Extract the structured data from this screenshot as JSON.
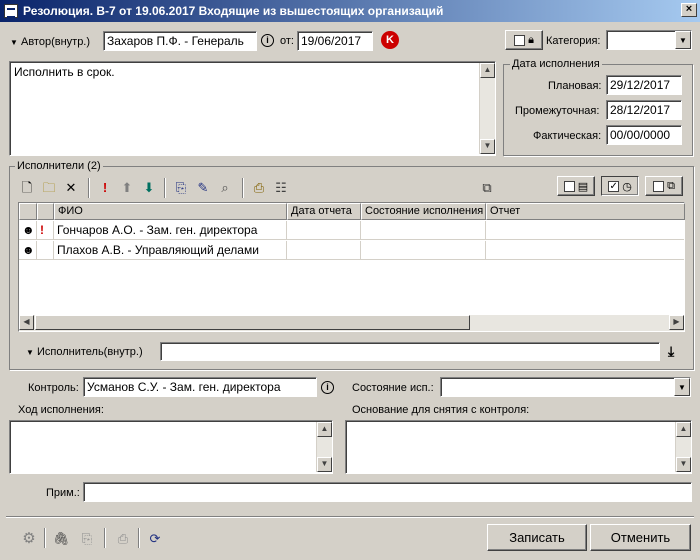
{
  "window": {
    "title": "Резолюция. В-7 от 19.06.2017 Входящие из вышестоящих организаций",
    "close_label": "×"
  },
  "header": {
    "author_label": "Автор(внутр.)",
    "author_value": "Захаров П.Ф. - Генераль",
    "from_label": "от:",
    "date_value": "19/06/2017",
    "k_badge": "K",
    "category_label": "Категория:",
    "category_value": ""
  },
  "resolution_text": "Исполнить в срок.",
  "due_dates": {
    "group_title": "Дата исполнения",
    "planned_label": "Плановая:",
    "planned_value": "29/12/2017",
    "interim_label": "Промежуточная:",
    "interim_value": "28/12/2017",
    "actual_label": "Фактическая:",
    "actual_value": "00/00/0000"
  },
  "executors": {
    "group_title": "Исполнители (2)",
    "columns": [
      "ФИО",
      "Дата отчета",
      "Состояние исполнения",
      "Отчет"
    ],
    "rows": [
      {
        "flag": "!",
        "name": "Гончаров А.О. - Зам. ген. директора",
        "report_date": "",
        "state": "",
        "report": ""
      },
      {
        "flag": "",
        "name": "Плахов А.В. - Управляющий делами",
        "report_date": "",
        "state": "",
        "report": ""
      }
    ],
    "executor_label": "Исполнитель(внутр.)",
    "executor_value": ""
  },
  "control": {
    "control_label": "Контроль:",
    "control_value": "Усманов С.У. - Зам. ген. директора",
    "state_label": "Состояние исп.:",
    "state_value": "",
    "progress_label": "Ход исполнения:",
    "progress_value": "",
    "basis_label": "Основание для снятия с контроля:",
    "basis_value": "",
    "note_label": "Прим.:",
    "note_value": ""
  },
  "footer": {
    "save_label": "Записать",
    "cancel_label": "Отменить"
  },
  "colors": {
    "titlebar_start": "#0a246a",
    "titlebar_end": "#a6caf0",
    "face": "#d4d0c8",
    "badge_red": "#cc0000"
  }
}
